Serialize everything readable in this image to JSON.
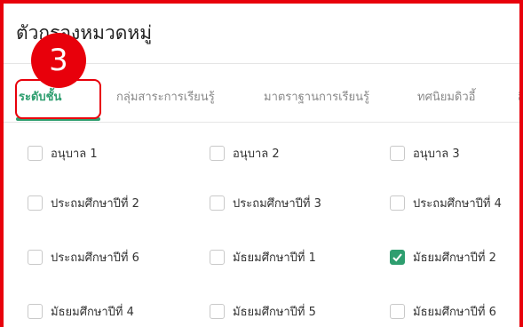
{
  "panel": {
    "title": "ตัวกรองหมวดหมู่"
  },
  "step_badge": "3",
  "tabs": [
    {
      "label": "ระดับชั้น",
      "active": true
    },
    {
      "label": "กลุ่มสาระการเรียนรู้",
      "active": false
    },
    {
      "label": "มาตราฐานการเรียนรู้",
      "active": false
    },
    {
      "label": "ทศนิยมดิวอี้",
      "active": false
    },
    {
      "label": "สื",
      "active": false
    }
  ],
  "options": [
    {
      "label": "อนุบาล 1",
      "checked": false
    },
    {
      "label": "อนุบาล 2",
      "checked": false
    },
    {
      "label": "อนุบาล 3",
      "checked": false
    },
    {
      "label": "ประถมศึกษาปีที่ 2",
      "checked": false
    },
    {
      "label": "ประถมศึกษาปีที่ 3",
      "checked": false
    },
    {
      "label": "ประถมศึกษาปีที่ 4",
      "checked": false
    },
    {
      "label": "ประถมศึกษาปีที่ 6",
      "checked": false
    },
    {
      "label": "มัธยมศึกษาปีที่ 1",
      "checked": false
    },
    {
      "label": "มัธยมศึกษาปีที่ 2",
      "checked": true
    },
    {
      "label": "มัธยมศึกษาปีที่ 4",
      "checked": false
    },
    {
      "label": "มัธยมศึกษาปีที่ 5",
      "checked": false
    },
    {
      "label": "มัธยมศึกษาปีที่ 6",
      "checked": false
    }
  ],
  "colors": {
    "accent": "#2e9e6f",
    "highlight": "#e8000b"
  },
  "icons": {
    "checked": "checkmark-icon"
  }
}
